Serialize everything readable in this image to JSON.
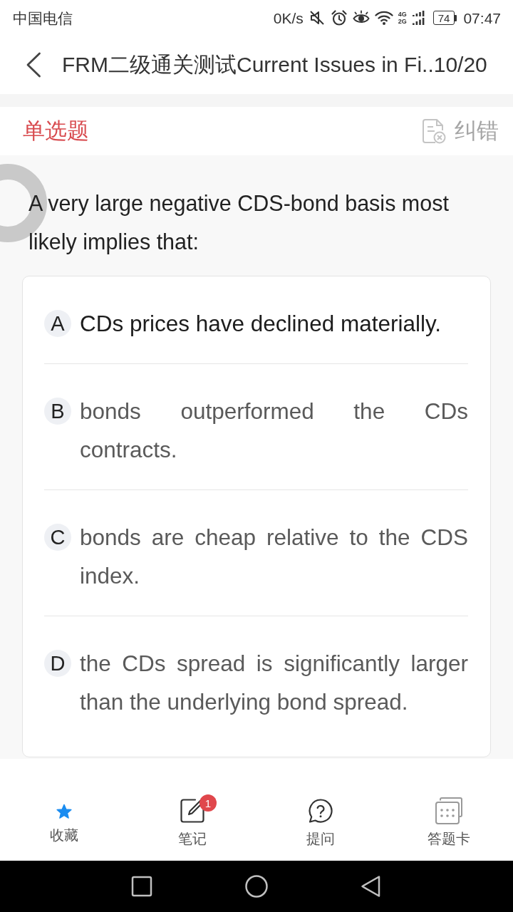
{
  "status_bar": {
    "carrier": "中国电信",
    "speed": "0K/s",
    "network_labels": [
      "4G",
      "2G"
    ],
    "battery": "74",
    "time": "07:47"
  },
  "header": {
    "title": "FRM二级通关测试Current Issues in Fi..",
    "counter": "10/20"
  },
  "question": {
    "type": "单选题",
    "report": "纠错",
    "text": "A very large negative CDS-bond basis most likely implies that:",
    "options": [
      {
        "letter": "A",
        "text": "CDs prices have declined materially.",
        "selected": true
      },
      {
        "letter": "B",
        "text": "bonds outperformed the CDs contracts.",
        "selected": false
      },
      {
        "letter": "C",
        "text": "bonds are cheap relative to the CDS index.",
        "selected": false
      },
      {
        "letter": "D",
        "text": "the CDs spread is significantly larger than the underlying bond spread.",
        "selected": false
      }
    ]
  },
  "bottom_bar": [
    {
      "kind": "star",
      "label": "收藏",
      "on": true
    },
    {
      "kind": "note",
      "label": "笔记",
      "badge": "1",
      "on": false
    },
    {
      "kind": "question",
      "label": "提问",
      "on": false
    },
    {
      "kind": "card",
      "label": "答题卡",
      "on": false
    }
  ]
}
